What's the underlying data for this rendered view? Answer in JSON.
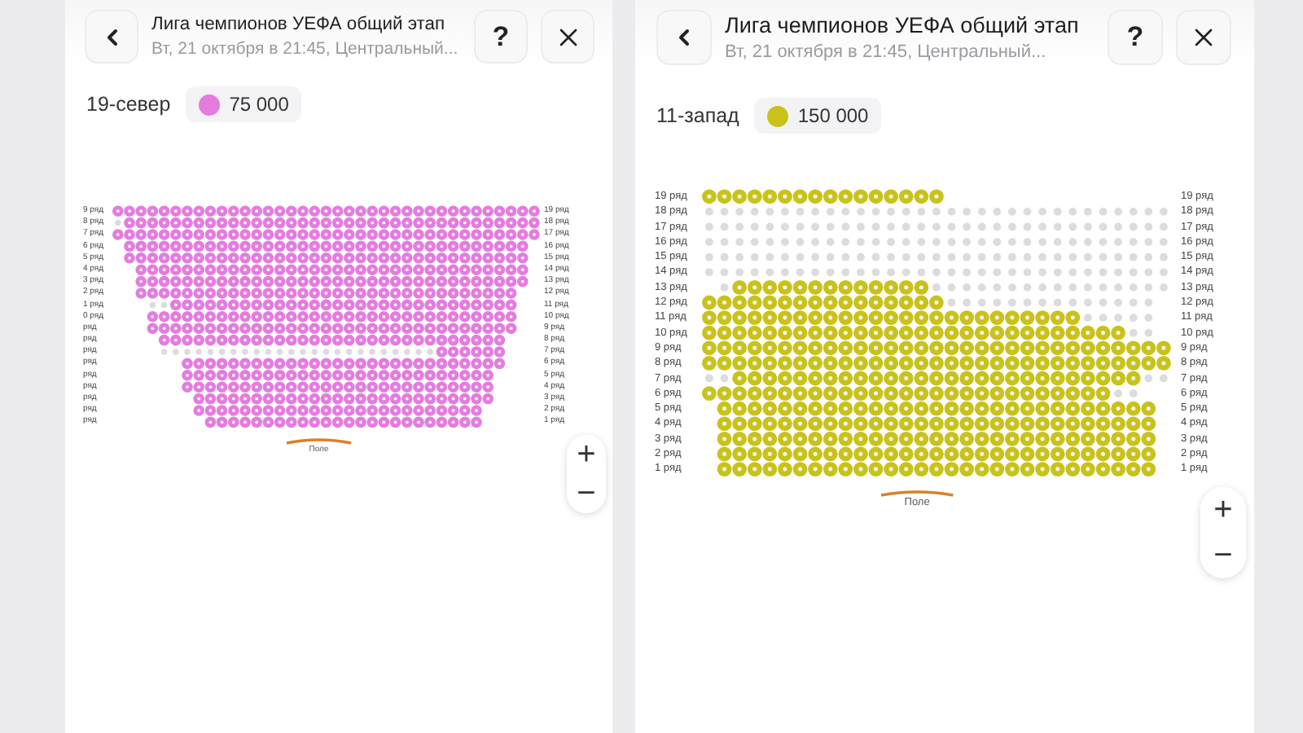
{
  "screens": [
    {
      "header": {
        "title": "Лига чемпионов УЕФА общий этап",
        "subtitle": "Вт, 21 октября в 21:45, Центральный...",
        "help": "?"
      },
      "sector": {
        "name": "19-север",
        "price": "75 000",
        "color": "#e47ce0"
      },
      "rows_left": [
        "9 ряд",
        "8 ряд",
        "7 ряд",
        "6 ряд",
        "5 ряд",
        "4 ряд",
        "3 ряд",
        "2 ряд",
        "1 ряд",
        "0 ряд",
        "ряд",
        "ряд",
        "ряд",
        "ряд",
        "ряд",
        "ряд",
        "ряд",
        "ряд",
        "ряд"
      ],
      "rows_right": [
        "19 ряд",
        "18 ряд",
        "17 ряд",
        "16 ряд",
        "15 ряд",
        "14 ряд",
        "13 ряд",
        "12 ряд",
        "11 ряд",
        "10 ряд",
        "9 ряд",
        "8 ряд",
        "7 ряд",
        "6 ряд",
        "5 ряд",
        "4 ряд",
        "3 ряд",
        "2 ряд",
        "1 ряд"
      ],
      "field_label": "Поле",
      "zoom_buttons": [
        "+",
        "−"
      ]
    },
    {
      "header": {
        "title": "Лига чемпионов УЕФА общий этап",
        "subtitle": "Вт, 21 октября в 21:45, Центральный...",
        "help": "?"
      },
      "sector": {
        "name": "11-запад",
        "price": "150 000",
        "color": "#c9c21c"
      },
      "rows_left": [
        "19 ряд",
        "18 ряд",
        "17 ряд",
        "16 ряд",
        "15 ряд",
        "14 ряд",
        "13 ряд",
        "12 ряд",
        "11 ряд",
        "10 ряд",
        "9 ряд",
        "8 ряд",
        "7 ряд",
        "6 ряд",
        "5 ряд",
        "4 ряд",
        "3 ряд",
        "2 ряд",
        "1 ряд"
      ],
      "rows_right": [
        "19 ряд",
        "18 ряд",
        "17 ряд",
        "16 ряд",
        "15 ряд",
        "14 ряд",
        "13 ряд",
        "12 ряд",
        "11 ряд",
        "10 ряд",
        "9 ряд",
        "8 ряд",
        "7 ряд",
        "6 ряд",
        "5 ряд",
        "4 ряд",
        "3 ряд",
        "2 ряд",
        "1 ряд"
      ],
      "field_label": "Поле",
      "zoom_buttons": [
        "+",
        "−"
      ]
    }
  ]
}
